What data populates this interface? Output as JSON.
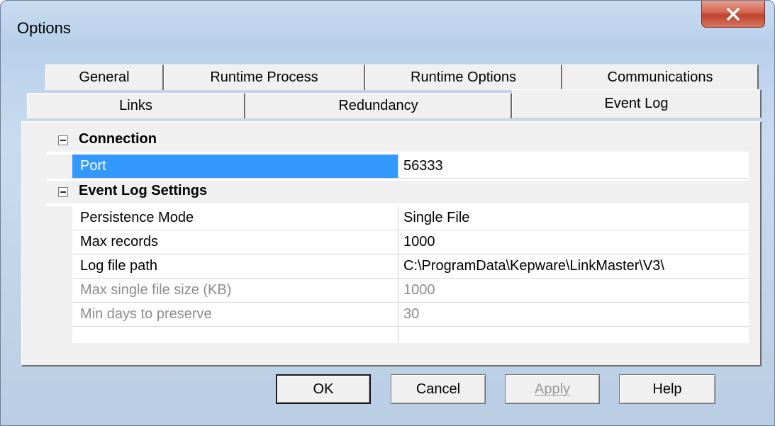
{
  "window": {
    "title": "Options",
    "close_label": "X"
  },
  "tabs_row1": [
    {
      "label": "General"
    },
    {
      "label": "Runtime Process"
    },
    {
      "label": "Runtime Options"
    },
    {
      "label": "Communications"
    }
  ],
  "tabs_row2": [
    {
      "label": "Links"
    },
    {
      "label": "Redundancy"
    },
    {
      "label": "Event Log",
      "active": true
    }
  ],
  "grid": {
    "categories": [
      {
        "label": "Connection"
      },
      {
        "label": "Event Log Settings"
      }
    ],
    "connection_props": [
      {
        "name": "Port",
        "value": "56333"
      }
    ],
    "event_log_props": [
      {
        "name": "Persistence Mode",
        "value": "Single File"
      },
      {
        "name": "Max records",
        "value": "1000"
      },
      {
        "name": "Log file path",
        "value": "C:\\ProgramData\\Kepware\\LinkMaster\\V3\\"
      },
      {
        "name": "Max single file size (KB)",
        "value": "1000"
      },
      {
        "name": "Min days to preserve",
        "value": "30"
      }
    ]
  },
  "buttons": {
    "ok": "OK",
    "cancel": "Cancel",
    "apply": "Apply",
    "help": "Help"
  },
  "colors": {
    "selection": "#3399ff",
    "close_button": "#c0432d",
    "disabled_text": "#8c8c8c"
  }
}
